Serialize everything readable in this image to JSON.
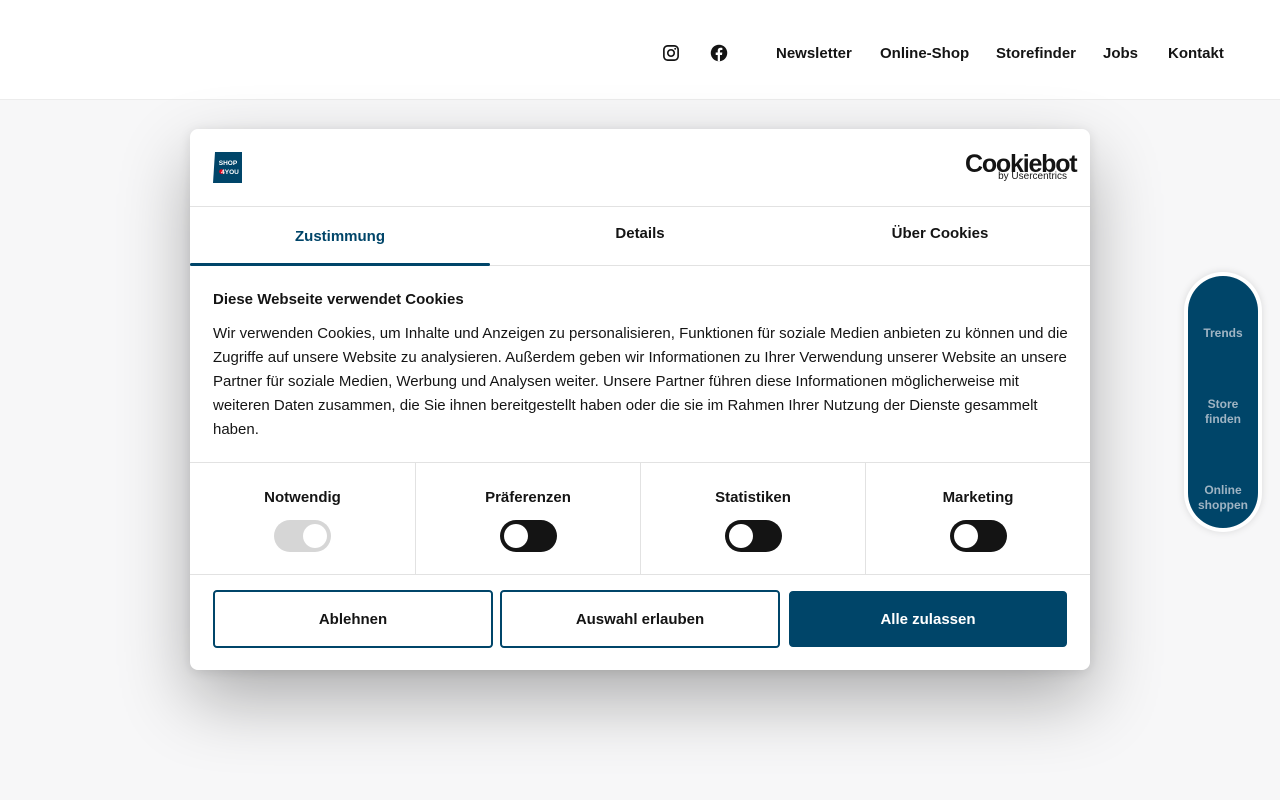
{
  "header": {
    "social": [
      {
        "icon": "instagram-icon"
      },
      {
        "icon": "facebook-icon"
      }
    ],
    "nav": [
      "Newsletter",
      "Online-Shop",
      "Storefinder",
      "Jobs",
      "Kontakt"
    ]
  },
  "side_panel": {
    "items": [
      {
        "label": "Trends"
      },
      {
        "label_line1": "Store",
        "label_line2": "finden"
      },
      {
        "label_line1": "Online",
        "label_line2": "shoppen"
      }
    ]
  },
  "dialog": {
    "brand_logo": {
      "line1": "SHOP",
      "line2": "4YOU"
    },
    "cookiebot": {
      "wordmark": "Cookiebot",
      "tagline": "by Usercentrics"
    },
    "tabs": [
      {
        "label": "Zustimmung",
        "active": true
      },
      {
        "label": "Details",
        "active": false
      },
      {
        "label": "Über Cookies",
        "active": false
      }
    ],
    "title": "Diese Webseite verwendet Cookies",
    "text": "Wir verwenden Cookies, um Inhalte und Anzeigen zu personalisieren, Funktionen für soziale Medien anbieten zu können und die Zugriffe auf unsere Website zu analysieren. Außerdem geben wir Informationen zu Ihrer Verwendung unserer Website an unsere Partner für soziale Medien, Werbung und Analysen weiter. Unsere Partner führen diese Informationen möglicherweise mit weiteren Daten zusammen, die Sie ihnen bereitgestellt haben oder die sie im Rahmen Ihrer Nutzung der Dienste gesammelt haben.",
    "toggles": [
      {
        "label": "Notwendig",
        "enabled": true,
        "disabled": true
      },
      {
        "label": "Präferenzen",
        "enabled": false,
        "disabled": false
      },
      {
        "label": "Statistiken",
        "enabled": false,
        "disabled": false
      },
      {
        "label": "Marketing",
        "enabled": false,
        "disabled": false
      }
    ],
    "buttons": {
      "decline": "Ablehnen",
      "allow_selection": "Auswahl erlauben",
      "allow_all": "Alle zulassen"
    }
  },
  "colors": {
    "accent": "#004569",
    "brand_red": "#e2001a",
    "text": "#141414",
    "page_bg": "#f7f7f8"
  }
}
